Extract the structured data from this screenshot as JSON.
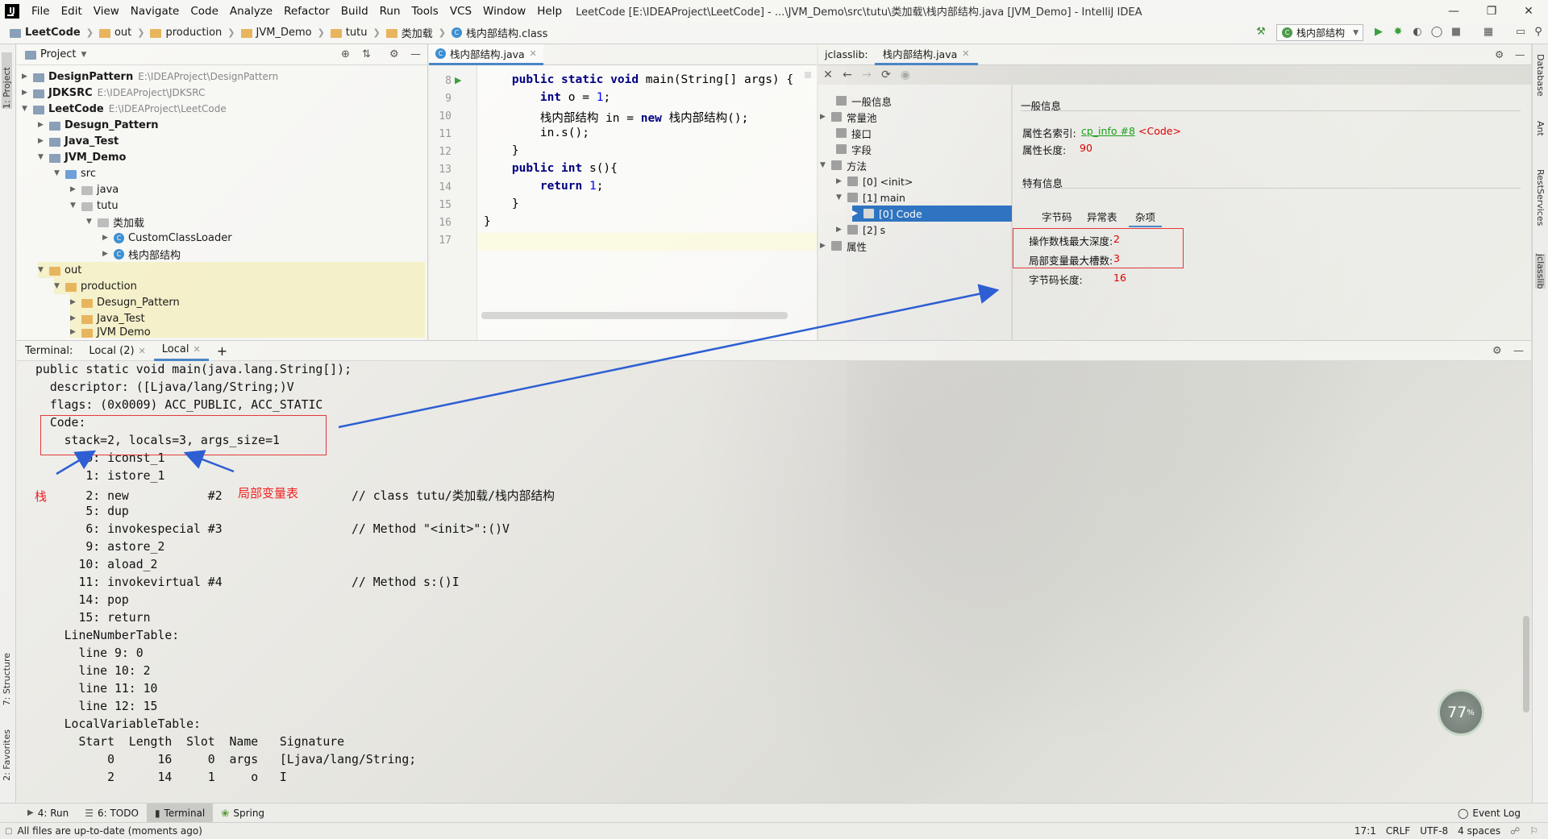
{
  "menubar": {
    "items": [
      "File",
      "Edit",
      "View",
      "Navigate",
      "Code",
      "Analyze",
      "Refactor",
      "Build",
      "Run",
      "Tools",
      "VCS",
      "Window",
      "Help"
    ],
    "window_title": "LeetCode [E:\\IDEAProject\\LeetCode] - ...\\JVM_Demo\\src\\tutu\\类加载\\栈内部结构.java [JVM_Demo] - IntelliJ IDEA"
  },
  "navbar": {
    "breadcrumbs": [
      "LeetCode",
      "out",
      "production",
      "JVM_Demo",
      "tutu",
      "类加载",
      "栈内部结构.class"
    ],
    "run_config": "栈内部结构"
  },
  "left_strip": {
    "project": "1: Project",
    "structure": "7: Structure",
    "favorites": "2: Favorites"
  },
  "right_strip": {
    "database": "Database",
    "ant": "Ant",
    "rest": "RestServices",
    "jclasslib": "jclasslib"
  },
  "project": {
    "title": "Project",
    "tree": [
      {
        "label": "DesignPattern",
        "path": "E:\\IDEAProject\\DesignPattern"
      },
      {
        "label": "JDKSRC",
        "path": "E:\\IDEAProject\\JDKSRC"
      },
      {
        "label": "LeetCode",
        "path": "E:\\IDEAProject\\LeetCode"
      },
      {
        "label": "Desugn_Pattern",
        "path": ""
      },
      {
        "label": "Java_Test",
        "path": ""
      },
      {
        "label": "JVM_Demo",
        "path": ""
      },
      {
        "label": "src",
        "path": ""
      },
      {
        "label": "java",
        "path": ""
      },
      {
        "label": "tutu",
        "path": ""
      },
      {
        "label": "类加载",
        "path": ""
      },
      {
        "label": "CustomClassLoader",
        "path": ""
      },
      {
        "label": "栈内部结构",
        "path": ""
      },
      {
        "label": "out",
        "path": ""
      },
      {
        "label": "production",
        "path": ""
      },
      {
        "label": "Desugn_Pattern",
        "path": ""
      },
      {
        "label": "Java_Test",
        "path": ""
      },
      {
        "label": "JVM Demo",
        "path": ""
      }
    ]
  },
  "editor": {
    "tab": "栈内部结构.java",
    "line_numbers": [
      "8",
      "9",
      "10",
      "11",
      "12",
      "13",
      "14",
      "15",
      "16",
      "17"
    ],
    "lines": [
      {
        "a": "    ",
        "kw1": "public static void",
        "b": " main(String[] args) {",
        "n": "",
        "c": ""
      },
      {
        "a": "        ",
        "kw1": "int",
        "b": " o = ",
        "n": "1",
        "c": ";"
      },
      {
        "a": "        栈内部结构 in = ",
        "kw1": "new",
        "b": " 栈内部结构();",
        "n": "",
        "c": ""
      },
      {
        "a": "        in.s();",
        "kw1": "",
        "b": "",
        "n": "",
        "c": ""
      },
      {
        "a": "    }",
        "kw1": "",
        "b": "",
        "n": "",
        "c": ""
      },
      {
        "a": "    ",
        "kw1": "public int",
        "b": " s(){",
        "n": "",
        "c": ""
      },
      {
        "a": "        ",
        "kw1": "return",
        "b": " ",
        "n": "1",
        "c": ";"
      },
      {
        "a": "    }",
        "kw1": "",
        "b": "",
        "n": "",
        "c": ""
      },
      {
        "a": "}",
        "kw1": "",
        "b": "",
        "n": "",
        "c": ""
      },
      {
        "a": "",
        "kw1": "",
        "b": "",
        "n": "",
        "c": ""
      }
    ]
  },
  "jclasslib": {
    "tab_label": "jclasslib:",
    "tab": "栈内部结构.java",
    "tree": [
      "一般信息",
      "常量池",
      "接口",
      "字段",
      "方法",
      "[0] <init>",
      "[1] main",
      "[0] Code",
      "[2] s",
      "属性"
    ],
    "general_title": "一般信息",
    "attr_name_label": "属性名索引:",
    "attr_name_link": "cp_info #8",
    "attr_name_value": "<Code>",
    "attr_length_label": "属性长度:",
    "attr_length_value": "90",
    "specific_title": "特有信息",
    "subtabs": [
      "字节码",
      "异常表",
      "杂项"
    ],
    "max_stack_label": "操作数栈最大深度:",
    "max_stack_value": "2",
    "max_locals_label": "局部变量最大槽数:",
    "max_locals_value": "3",
    "code_length_label": "字节码长度:",
    "code_length_value": "16"
  },
  "terminal": {
    "label": "Terminal:",
    "tabs": [
      "Local (2)",
      "Local"
    ],
    "lines": [
      "public static void main(java.lang.String[]);",
      "  descriptor: ([Ljava/lang/String;)V",
      "  flags: (0x0009) ACC_PUBLIC, ACC_STATIC",
      "  Code:",
      "    stack=2, locals=3, args_size=1",
      "       0: iconst_1",
      "       1: istore_1",
      "       2: new           #2                  // class tutu/类加载/栈内部结构",
      "       5: dup",
      "       6: invokespecial #3                  // Method \"<init>\":()V",
      "       9: astore_2",
      "      10: aload_2",
      "      11: invokevirtual #4                  // Method s:()I",
      "      14: pop",
      "      15: return",
      "    LineNumberTable:",
      "      line 9: 0",
      "      line 10: 2",
      "      line 11: 10",
      "      line 12: 15",
      "    LocalVariableTable:",
      "      Start  Length  Slot  Name   Signature",
      "          0      16     0  args   [Ljava/lang/String;",
      "          2      14     1     o   I"
    ],
    "annotations": {
      "stack": "栈",
      "locals": "局部变量表"
    }
  },
  "tool_windows": [
    "4: Run",
    "6: TODO",
    "Terminal",
    "Spring"
  ],
  "event_log": "Event Log",
  "status": {
    "message": "All files are up-to-date (moments ago)",
    "position": "17:1",
    "line_sep": "CRLF",
    "encoding": "UTF-8",
    "indent": "4 spaces"
  },
  "perf": {
    "value": "77",
    "unit": "%"
  },
  "colors": {
    "accent": "#4a86c5",
    "annotation_red": "#e23a3a",
    "arrow_blue": "#2d5fd3"
  }
}
